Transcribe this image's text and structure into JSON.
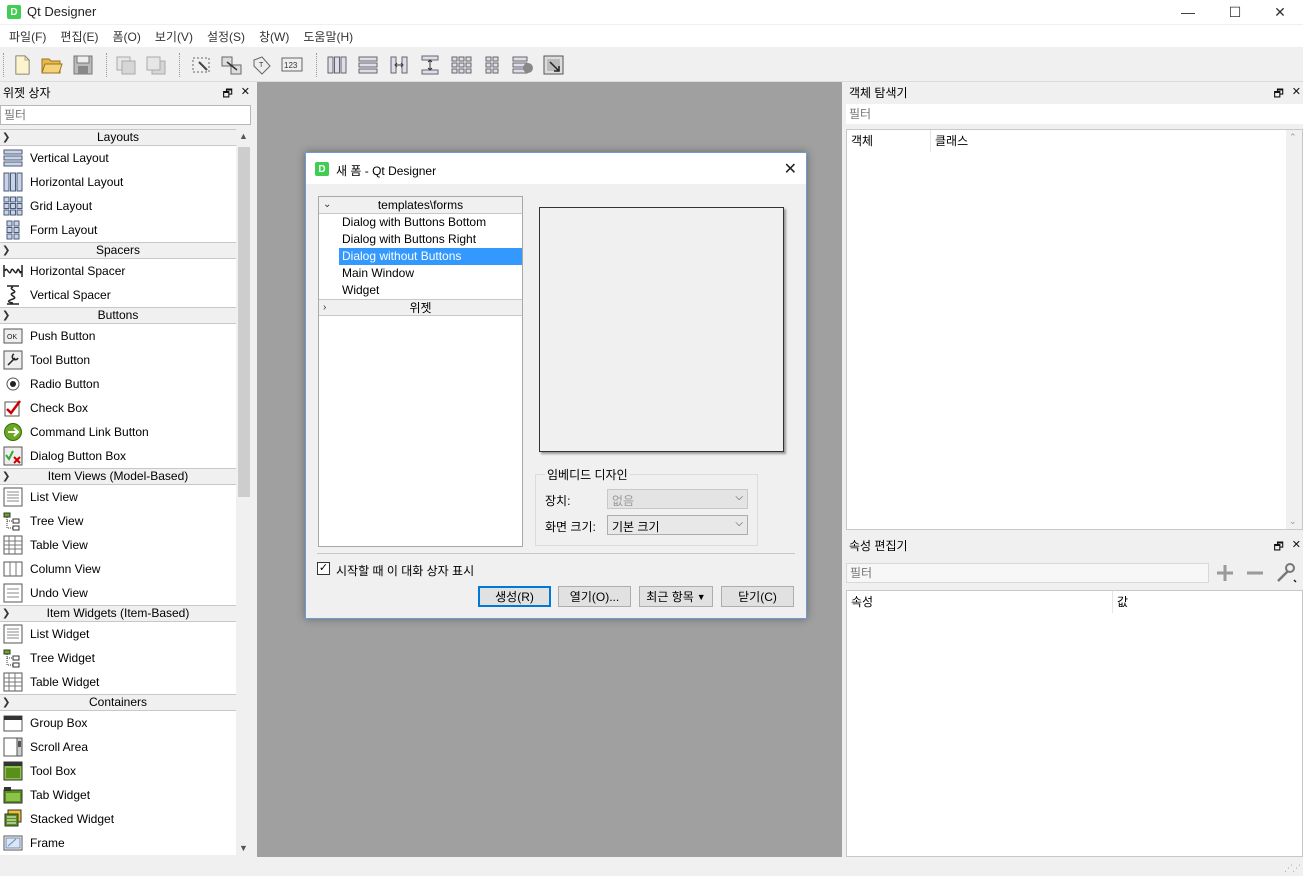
{
  "window": {
    "title": "Qt Designer",
    "app_icon_letter": "D",
    "controls": {
      "minimize": "—",
      "maximize": "☐",
      "close": "✕"
    }
  },
  "menu": [
    "파일(F)",
    "편집(E)",
    "폼(O)",
    "보기(V)",
    "설정(S)",
    "창(W)",
    "도움말(H)"
  ],
  "toolbar": {
    "buttons": [
      "new-file",
      "open-folder",
      "save",
      "raise",
      "lower",
      "edit-widgets",
      "edit-signals-slots",
      "edit-buddies",
      "edit-tab-order",
      "layout-horizontal",
      "layout-vertical",
      "layout-horizontal-splitter",
      "layout-vertical-splitter",
      "layout-grid",
      "layout-form",
      "break-layout",
      "adjust-size"
    ]
  },
  "widget_box": {
    "title": "위젯 상자",
    "filter_placeholder": "필터",
    "categories": [
      {
        "name": "Layouts",
        "items": [
          {
            "label": "Vertical Layout",
            "icon": "vertical-layout-icon"
          },
          {
            "label": "Horizontal Layout",
            "icon": "horizontal-layout-icon"
          },
          {
            "label": "Grid Layout",
            "icon": "grid-layout-icon"
          },
          {
            "label": "Form Layout",
            "icon": "form-layout-icon"
          }
        ]
      },
      {
        "name": "Spacers",
        "items": [
          {
            "label": "Horizontal Spacer",
            "icon": "horizontal-spacer-icon"
          },
          {
            "label": "Vertical Spacer",
            "icon": "vertical-spacer-icon"
          }
        ]
      },
      {
        "name": "Buttons",
        "items": [
          {
            "label": "Push Button",
            "icon": "push-button-icon"
          },
          {
            "label": "Tool Button",
            "icon": "tool-button-icon"
          },
          {
            "label": "Radio Button",
            "icon": "radio-button-icon"
          },
          {
            "label": "Check Box",
            "icon": "check-box-icon"
          },
          {
            "label": "Command Link Button",
            "icon": "command-link-icon"
          },
          {
            "label": "Dialog Button Box",
            "icon": "dialog-button-box-icon"
          }
        ]
      },
      {
        "name": "Item Views (Model-Based)",
        "items": [
          {
            "label": "List View",
            "icon": "list-view-icon"
          },
          {
            "label": "Tree View",
            "icon": "tree-view-icon"
          },
          {
            "label": "Table View",
            "icon": "table-view-icon"
          },
          {
            "label": "Column View",
            "icon": "column-view-icon"
          },
          {
            "label": "Undo View",
            "icon": "undo-view-icon"
          }
        ]
      },
      {
        "name": "Item Widgets (Item-Based)",
        "items": [
          {
            "label": "List Widget",
            "icon": "list-widget-icon"
          },
          {
            "label": "Tree Widget",
            "icon": "tree-widget-icon"
          },
          {
            "label": "Table Widget",
            "icon": "table-widget-icon"
          }
        ]
      },
      {
        "name": "Containers",
        "items": [
          {
            "label": "Group Box",
            "icon": "group-box-icon"
          },
          {
            "label": "Scroll Area",
            "icon": "scroll-area-icon"
          },
          {
            "label": "Tool Box",
            "icon": "tool-box-icon"
          },
          {
            "label": "Tab Widget",
            "icon": "tab-widget-icon"
          },
          {
            "label": "Stacked Widget",
            "icon": "stacked-widget-icon"
          },
          {
            "label": "Frame",
            "icon": "frame-icon"
          }
        ]
      }
    ]
  },
  "dialog": {
    "title": "새 폼 - Qt Designer",
    "tree": {
      "group1": "templates\\forms",
      "items": [
        "Dialog with Buttons Bottom",
        "Dialog with Buttons Right",
        "Dialog without Buttons",
        "Main Window",
        "Widget"
      ],
      "selected_index": 2,
      "group2": "위젯"
    },
    "embedded_design": {
      "legend": "임베디드 디자인",
      "device_label": "장치:",
      "device_value": "없음",
      "screen_size_label": "화면 크기:",
      "screen_size_value": "기본 크기"
    },
    "show_on_startup": {
      "label": "시작할 때 이 대화 상자 표시",
      "checked": true
    },
    "buttons": {
      "create": "생성(R)",
      "open": "열기(O)...",
      "recent": "최근 항목",
      "close": "닫기(C)"
    }
  },
  "object_inspector": {
    "title": "객체 탐색기",
    "filter_placeholder": "필터",
    "columns": [
      "객체",
      "클래스"
    ]
  },
  "property_editor": {
    "title": "속성 편집기",
    "filter_placeholder": "필터",
    "columns": [
      "속성",
      "값"
    ]
  },
  "colors": {
    "selection": "#3399ff",
    "mdi_background": "#a0a0a0",
    "default_button_border": "#0078d7"
  }
}
